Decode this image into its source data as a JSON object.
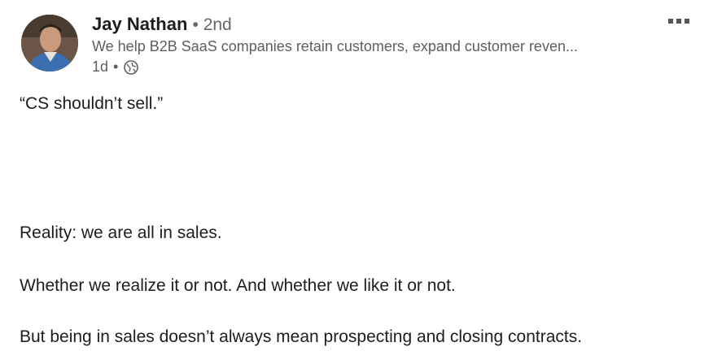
{
  "author": {
    "name": "Jay Nathan",
    "degree": "• 2nd",
    "headline": "We help B2B SaaS companies retain customers, expand customer reven...",
    "time": "1d",
    "separator": "•"
  },
  "icons": {
    "visibility": "globe-icon",
    "more": "more-options-icon"
  },
  "post": {
    "paragraphs": [
      "“CS shouldn’t sell.”",
      "Reality: we are all in sales.",
      "Whether we realize it or not. And whether we like it or not.",
      "But being in sales doesn’t always mean prospecting and closing contracts."
    ]
  }
}
